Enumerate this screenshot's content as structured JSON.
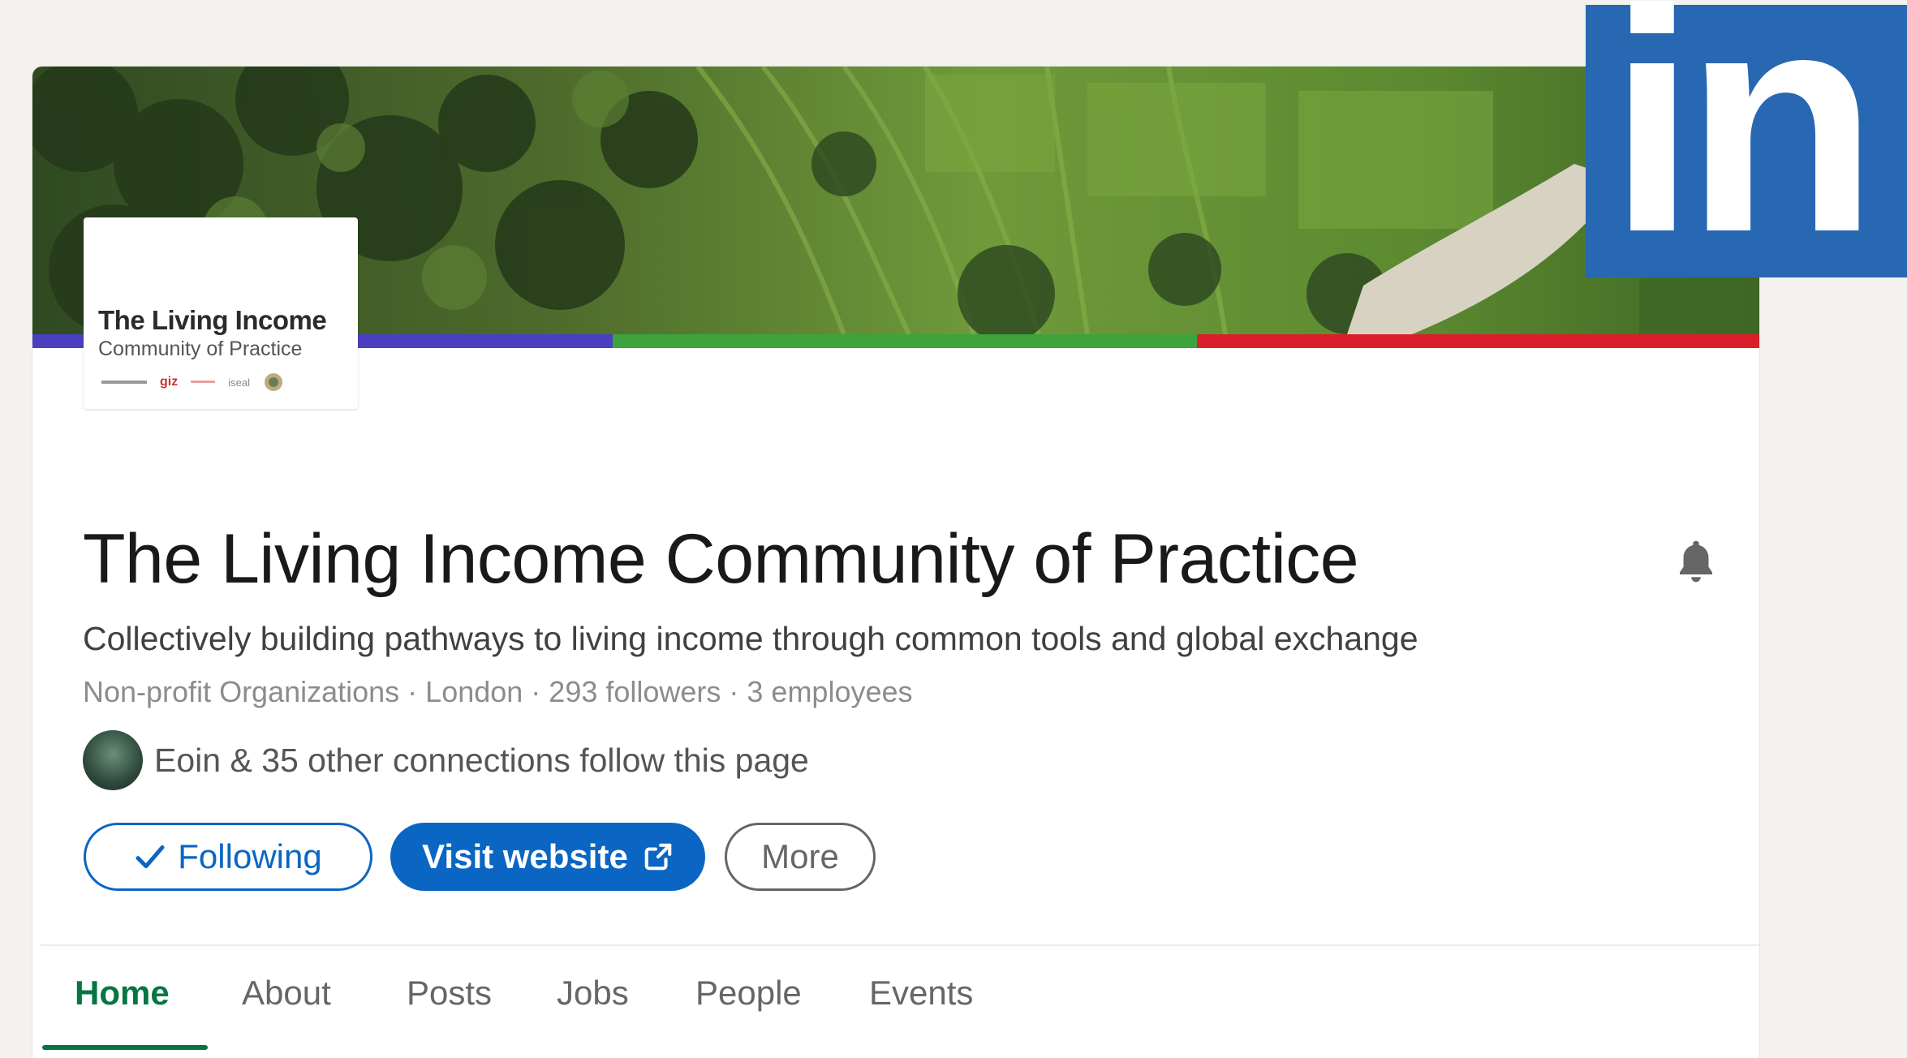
{
  "org": {
    "name": "The Living Income Community of Practice",
    "tagline": "Collectively building pathways to living income through common tools and global exchange",
    "meta": "Non-profit Organizations · London · 293 followers · 3 employees",
    "logo_line1": "The Living Income",
    "logo_line2": "Community of Practice",
    "logo_partner_giz": "giz",
    "logo_partner_iseal": "iseal"
  },
  "connections": {
    "text": "Eoin & 35 other connections follow this page"
  },
  "actions": {
    "following_label": "Following",
    "visit_label": "Visit website",
    "more_label": "More"
  },
  "tabs": [
    {
      "label": "Home"
    },
    {
      "label": "About"
    },
    {
      "label": "Posts"
    },
    {
      "label": "Jobs"
    },
    {
      "label": "People"
    },
    {
      "label": "Events"
    }
  ],
  "linkedin_logo": {
    "text": "in"
  },
  "colors": {
    "linkedin_blue": "#0a66c2",
    "logo_blue": "#2867b2",
    "active_green": "#057642",
    "strip_purple": "#4b3fbf",
    "strip_green": "#3da43d",
    "strip_red": "#d91f2a"
  },
  "icons": {
    "check": "check-icon",
    "external": "external-link-icon",
    "bell": "bell-icon"
  }
}
